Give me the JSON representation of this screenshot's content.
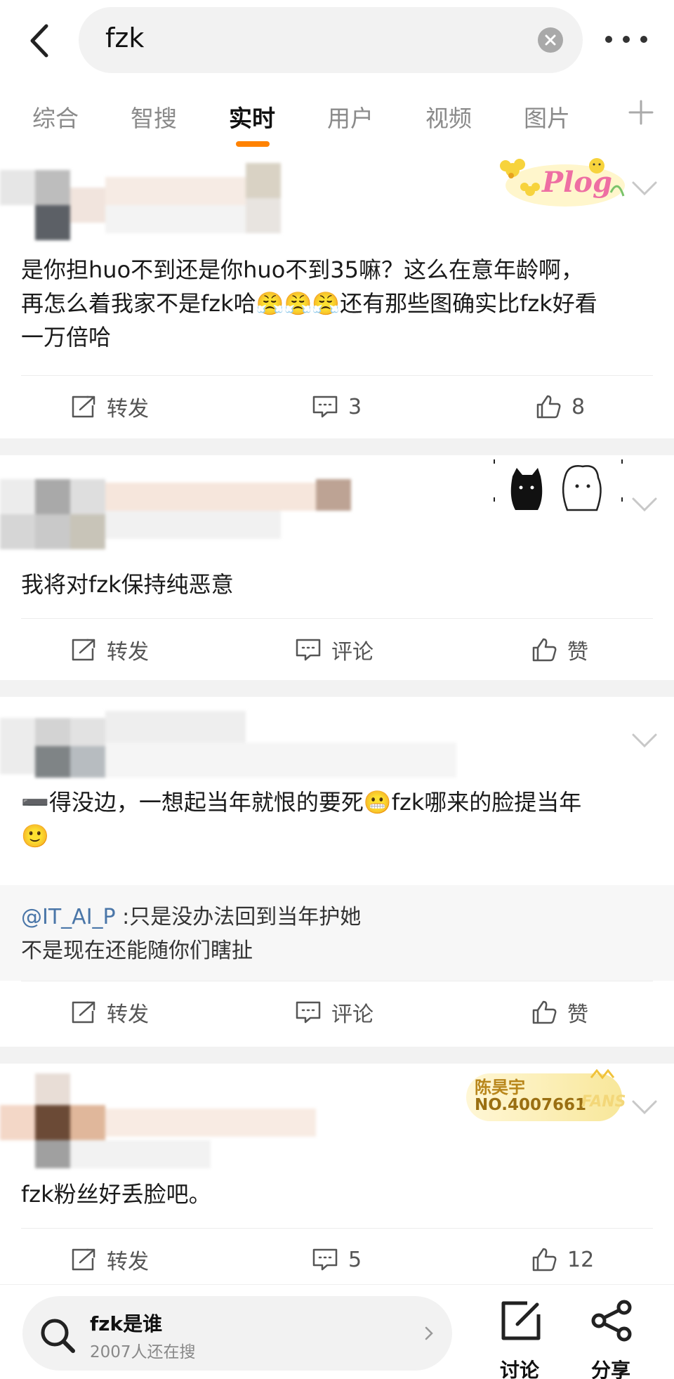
{
  "search": {
    "query": "fzk"
  },
  "tabs": [
    {
      "label": "综合"
    },
    {
      "label": "智搜"
    },
    {
      "label": "实时",
      "active": true
    },
    {
      "label": "用户"
    },
    {
      "label": "视频"
    },
    {
      "label": "图片"
    }
  ],
  "posts": [
    {
      "text_lines": [
        "是你担huo不到还是你huo不到35嘛？这么在意年龄啊，",
        "再怎么着我家不是fzk哈😤😤😤还有那些图确实比fzk好看",
        "一万倍哈"
      ],
      "badge_text": "Plog",
      "actions": {
        "repost": "转发",
        "comment": "3",
        "like": "8"
      }
    },
    {
      "text_lines": [
        "我将对fzk保持纯恶意"
      ],
      "actions": {
        "repost": "转发",
        "comment": "评论",
        "like": "赞"
      }
    },
    {
      "text_lines": [
        "➖得没边，一想起当年就恨的要死😬fzk哪来的脸提当年",
        "🙂"
      ],
      "quote_lines": [
        {
          "mention": "@IT_AI_P",
          "text": " :只是没办法回到当年护她"
        },
        {
          "mention": "",
          "text": "不是现在还能随你们瞎扯"
        }
      ],
      "actions": {
        "repost": "转发",
        "comment": "评论",
        "like": "赞"
      }
    },
    {
      "text_lines": [
        "fzk粉丝好丢脸吧。"
      ],
      "badge_name": "陈昊宇",
      "badge_no": "NO.4007661",
      "badge_fans": "FANS",
      "actions": {
        "repost": "转发",
        "comment": "5",
        "like": "12"
      }
    }
  ],
  "bottom_bar": {
    "hot_title": "fzk是谁",
    "hot_sub": "2007人还在搜",
    "discuss": "讨论",
    "share": "分享"
  },
  "colors": {
    "accent": "#ff8200",
    "mention": "#4a76a8",
    "separator": "#f2f2f2"
  }
}
